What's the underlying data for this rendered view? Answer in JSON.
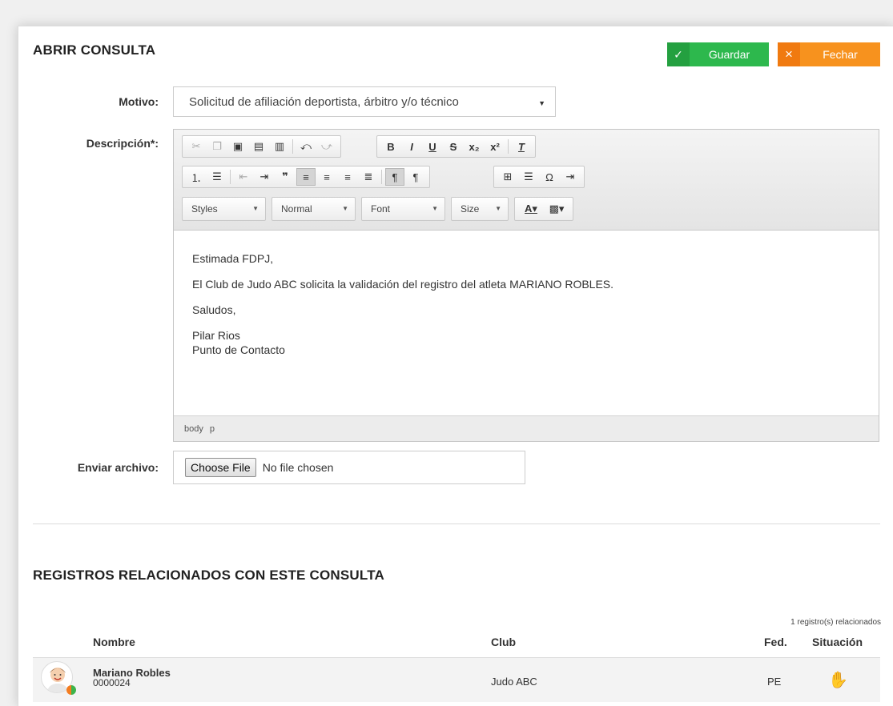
{
  "header": {
    "title": "ABRIR CONSULTA",
    "save_label": "Guardar",
    "save_icon": "check-icon",
    "close_label": "Fechar",
    "close_icon": "x-icon"
  },
  "form": {
    "motivo_label": "Motivo:",
    "motivo_value": "Solicitud de afiliación deportista, árbitro y/o técnico",
    "descripcion_label": "Descripción*:",
    "archivo_label": "Enviar archivo:",
    "file_button": "Choose File",
    "file_status": "No file chosen"
  },
  "editor": {
    "combos": {
      "styles": "Styles",
      "format": "Normal",
      "font": "Font",
      "size": "Size"
    },
    "content": {
      "greeting": "Estimada FDPJ,",
      "body": "El Club de Judo ABC solicita la validación del registro del atleta MARIANO ROBLES.",
      "closing": "Saludos,",
      "signature_name": "Pilar Rios",
      "signature_role": "Punto de Contacto"
    },
    "path": [
      "body",
      "p"
    ]
  },
  "related": {
    "title": "REGISTROS RELACIONADOS CON ESTE CONSULTA",
    "count": "1 registro(s) relacionados",
    "columns": {
      "name": "Nombre",
      "club": "Club",
      "fed": "Fed.",
      "status": "Situación"
    },
    "rows": [
      {
        "name": "Mariano Robles",
        "id": "0000024",
        "club": "Judo ABC",
        "fed": "PE",
        "status_icon": "hand-icon"
      }
    ]
  },
  "colors": {
    "save": "#2db84d",
    "close": "#f7921e",
    "status_hand": "#f4b400"
  }
}
